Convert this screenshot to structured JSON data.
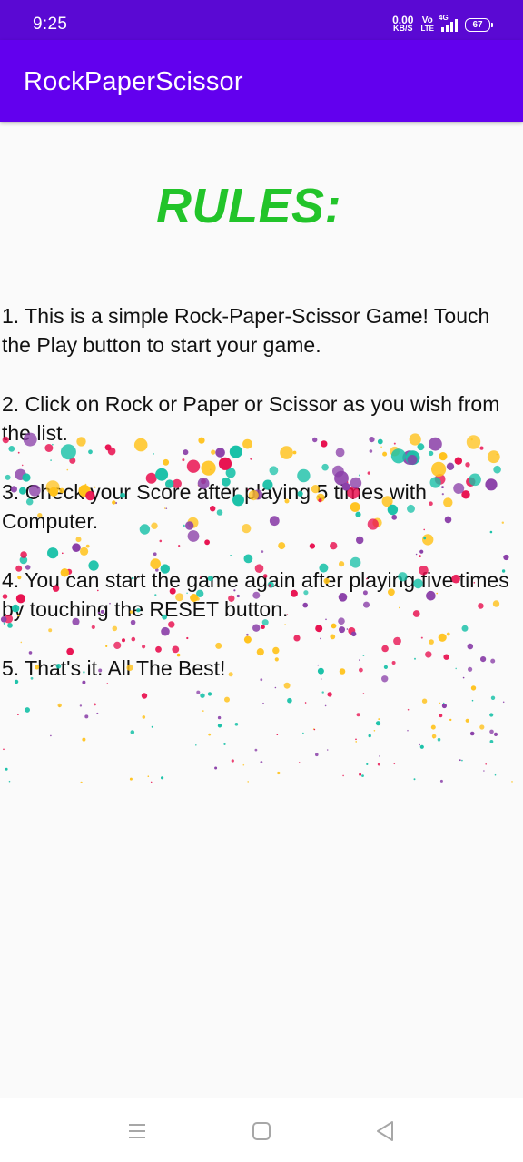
{
  "status_bar": {
    "time": "9:25",
    "net_speed_value": "0.00",
    "net_speed_unit": "KB/S",
    "volte_top": "Vo",
    "volte_bottom": "LTE",
    "network_type": "4G",
    "battery_level": "67"
  },
  "app_bar": {
    "title": "RockPaperScissor"
  },
  "rules": {
    "heading": "RULES:",
    "items": [
      "1. This is a simple Rock-Paper-Scissor Game! Touch the Play button to start your game.",
      "2. Click on Rock or Paper or Scissor as you wish from the list.",
      "3. Check your Score after playing 5 times with Computer.",
      "4. You can start the game again after playing five times by touching the RESET button.",
      "5. That's it. All The Best!"
    ]
  },
  "confetti_colors": [
    "#e8104f",
    "#ffc21b",
    "#19c1a8",
    "#8a3fa8"
  ],
  "nav_bar": {
    "icons": [
      "menu-icon",
      "home-square-icon",
      "back-triangle-icon"
    ]
  }
}
